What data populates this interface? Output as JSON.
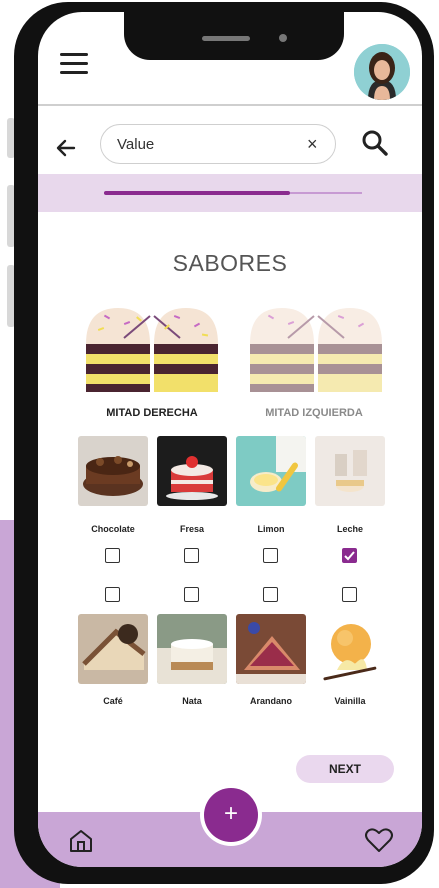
{
  "header": {
    "menu_icon": "hamburger-menu-icon",
    "avatar_icon": "user-avatar"
  },
  "search": {
    "value": "Value",
    "back_icon": "arrow-left-icon",
    "clear_label": "×",
    "search_icon": "magnifier-icon"
  },
  "progress": {
    "fraction": 0.72
  },
  "main": {
    "title": "SABORES",
    "halves": [
      {
        "label": "MITAD DERECHA",
        "active": true
      },
      {
        "label": "MITAD IZQUIERDA",
        "active": false
      }
    ],
    "flavors_row1": [
      {
        "label": "Chocolate",
        "checked": false
      },
      {
        "label": "Fresa",
        "checked": false
      },
      {
        "label": "Limon",
        "checked": false
      },
      {
        "label": "Leche",
        "checked": true
      }
    ],
    "flavors_row2": [
      {
        "label": "Café",
        "checked": false
      },
      {
        "label": "Nata",
        "checked": false
      },
      {
        "label": "Arandano",
        "checked": false
      },
      {
        "label": "Vainilla",
        "checked": false
      }
    ],
    "next_label": "NEXT"
  },
  "bottom_nav": {
    "fab_label": "+",
    "home_icon": "home-icon",
    "heart_icon": "heart-icon"
  },
  "colors": {
    "accent": "#8a2b8f",
    "accent_light": "#ead8ee",
    "bottom_bar": "#c9a6d6"
  }
}
